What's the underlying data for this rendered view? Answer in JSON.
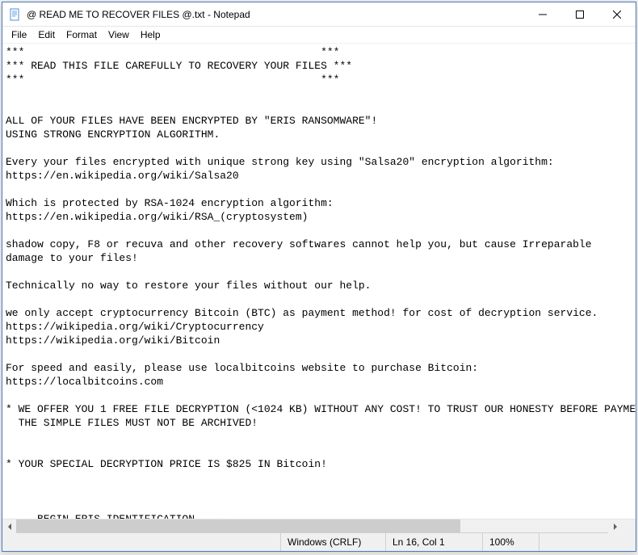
{
  "window": {
    "title": "@ READ ME TO RECOVER FILES @.txt - Notepad"
  },
  "menubar": {
    "file": "File",
    "edit": "Edit",
    "format": "Format",
    "view": "View",
    "help": "Help"
  },
  "content": {
    "text": "***                                               ***\n*** READ THIS FILE CAREFULLY TO RECOVERY YOUR FILES ***\n***                                               ***\n\n\nALL OF YOUR FILES HAVE BEEN ENCRYPTED BY \"ERIS RANSOMWARE\"!\nUSING STRONG ENCRYPTION ALGORITHM.\n\nEvery your files encrypted with unique strong key using \"Salsa20\" encryption algorithm:\nhttps://en.wikipedia.org/wiki/Salsa20\n\nWhich is protected by RSA-1024 encryption algorithm:\nhttps://en.wikipedia.org/wiki/RSA_(cryptosystem)\n\nshadow copy, F8 or recuva and other recovery softwares cannot help you, but cause Irreparable\ndamage to your files!\n\nTechnically no way to restore your files without our help.\n\nwe only accept cryptocurrency Bitcoin (BTC) as payment method! for cost of decryption service.\nhttps://wikipedia.org/wiki/Cryptocurrency\nhttps://wikipedia.org/wiki/Bitcoin\n\nFor speed and easily, please use localbitcoins website to purchase Bitcoin:\nhttps://localbitcoins.com\n\n* WE OFFER YOU 1 FREE FILE DECRYPTION (<1024 KB) WITHOUT ANY COST! TO TRUST OUR HONESTY BEFORE PAYMENT\n  THE SIMPLE FILES MUST NOT BE ARCHIVED!\n\n\n* YOUR SPECIAL DECRYPTION PRICE IS $825 IN Bitcoin!\n\n\n\n-----BEGIN ERIS IDENTIFICATION-----\n-\n-----END ERIS IDENTIFICATION-----\n"
  },
  "statusbar": {
    "encoding": "Windows (CRLF)",
    "position": "Ln 16, Col 1",
    "zoom": "100%"
  }
}
